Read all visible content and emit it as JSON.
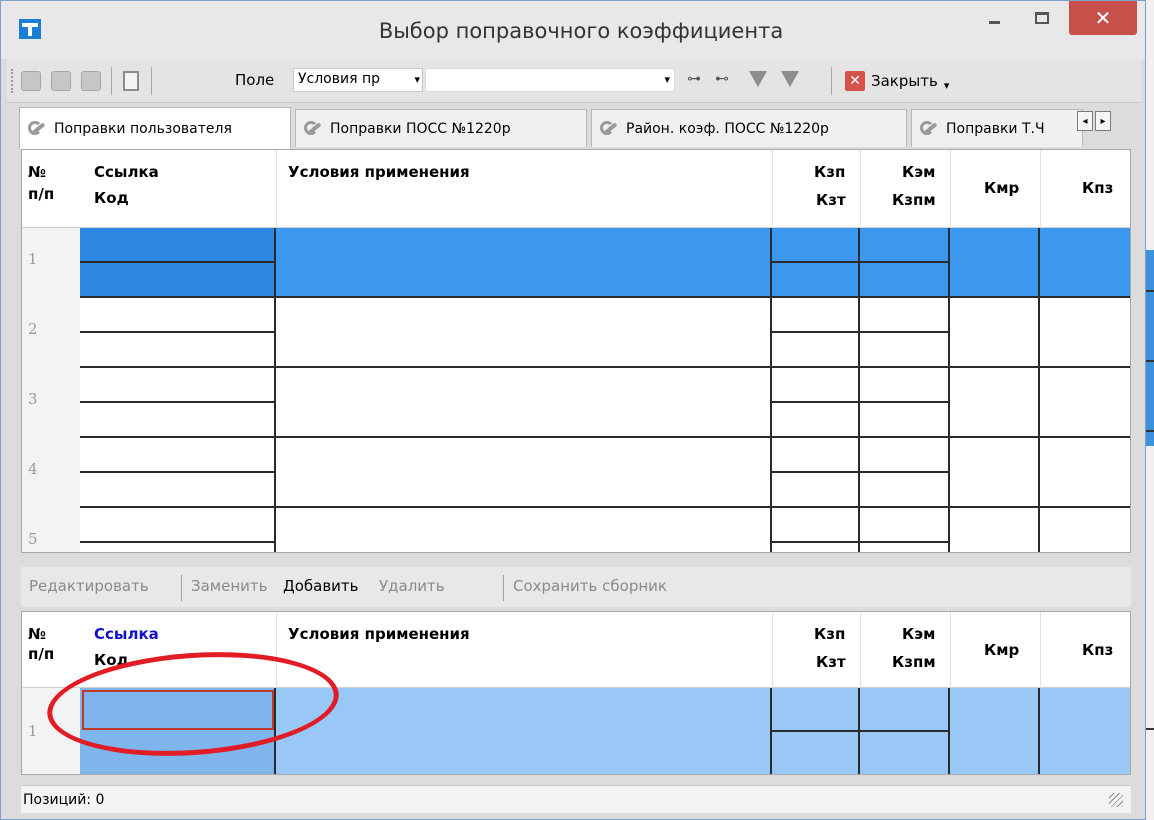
{
  "window": {
    "title": "Выбор поправочного коэффициента"
  },
  "toolbar": {
    "field_label": "Поле",
    "field_value": "Условия пр",
    "search_value": "",
    "close_label": "Закрыть"
  },
  "tabs": [
    {
      "label": "Поправки пользователя"
    },
    {
      "label": "Поправки ПОСС №1220р"
    },
    {
      "label": "Район. коэф. ПОСС №1220р"
    },
    {
      "label": "Поправки Т.Ч"
    }
  ],
  "top_grid": {
    "headers": {
      "num_1": "№",
      "num_2": "п/п",
      "ref": "Ссылка",
      "code": "Код",
      "cond": "Условия применения",
      "kzp": "Кзп",
      "kzt": "Кзт",
      "kem": "Кэм",
      "kzpm": "Кзпм",
      "kmr": "Кмр",
      "kpz": "Кпз"
    },
    "rows": [
      "1",
      "2",
      "3",
      "4",
      "5"
    ]
  },
  "actions": {
    "edit": "Редактировать",
    "replace": "Заменить",
    "add": "Добавить",
    "delete": "Удалить",
    "save": "Сохранить сборник"
  },
  "bottom_grid": {
    "headers": {
      "num_1": "№",
      "num_2": "п/п",
      "ref": "Ссылка",
      "code": "Код",
      "cond": "Условия применения",
      "kzp": "Кзп",
      "kzt": "Кзт",
      "kem": "Кэм",
      "kzpm": "Кзпм",
      "kmr": "Кмр",
      "kpz": "Кпз"
    },
    "rows": [
      "1"
    ]
  },
  "status": {
    "positions": "Позиций: 0"
  },
  "colors": {
    "selection": "#3c97ee",
    "selection_light": "#99c8f6",
    "annotation": "#e21c24",
    "close": "#c7504a"
  }
}
